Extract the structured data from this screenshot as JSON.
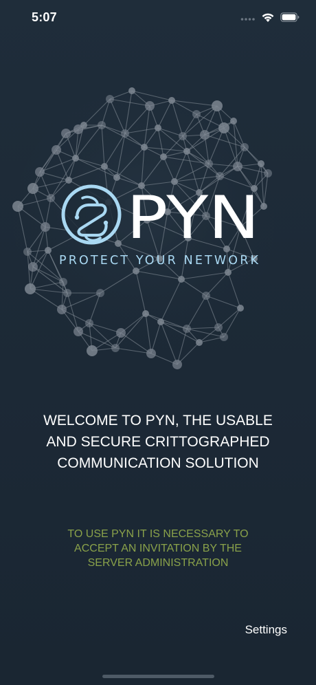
{
  "status_bar": {
    "time": "5:07"
  },
  "logo": {
    "wordmark": "PYN",
    "tagline": "PROTECT YOUR NETWORK"
  },
  "welcome": {
    "lines": [
      "WELCOME TO PYN, THE USABLE",
      "AND SECURE CRITTOGRAPHED",
      "COMMUNICATION SOLUTION"
    ]
  },
  "notice": {
    "lines": [
      "TO USE PYN IT IS NECESSARY TO",
      "ACCEPT AN INVITATION BY THE",
      "SERVER ADMINISTRATION"
    ]
  },
  "settings_label": "Settings",
  "colors": {
    "background": "#1f2d3a",
    "notice_text": "#8aa24a",
    "logo_accent": "#a9d8f2",
    "network_nodes": "#7d8691"
  }
}
